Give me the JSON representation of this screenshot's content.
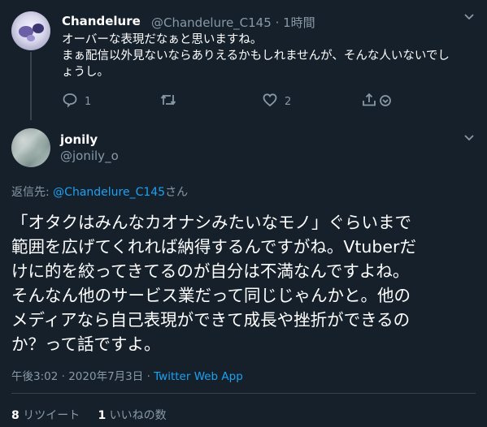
{
  "parent_tweet": {
    "display_name": "Chandelure",
    "handle": "@Chandelure_C145",
    "separator": "·",
    "time_ago": "1時間",
    "text": "オーバーな表現だなぁと思いますね。\nまぁ配信以外見ないならありえるかもしれませんが、そんな人いないでし\nょうし。",
    "reply_count": "1",
    "like_count": "2",
    "icons": [
      "reply-icon",
      "retweet-icon",
      "like-icon",
      "share-icon",
      "chevron-down-icon"
    ]
  },
  "main_tweet": {
    "display_name": "jonily",
    "handle": "@jonily_o",
    "reply_prefix": "返信先: ",
    "reply_to": "@Chandelure_C145",
    "reply_suffix": "さん",
    "text": "「オタクはみんなカオナシみたいなモノ」ぐらいまで\n範囲を広げてくれれば納得するんですがね。Vtuberだ\nけに的を絞ってきてるのが自分は不満なんですよね。\nそんなん他のサービス業だって同じじゃんかと。他の\nメディアなら自己表現ができて成長や挫折ができるの\nか？って話ですよ。",
    "time": "午後3:02",
    "dot": "·",
    "date": "2020年7月3日",
    "source": "Twitter Web App",
    "retweet_count": "8",
    "retweet_label": "リツイート",
    "like_count": "1",
    "like_label": "いいねの数"
  },
  "colors": {
    "background": "#15202b",
    "text": "#ffffff",
    "muted": "#8899a6",
    "accent": "#1da1f2",
    "divider": "#38444d"
  }
}
